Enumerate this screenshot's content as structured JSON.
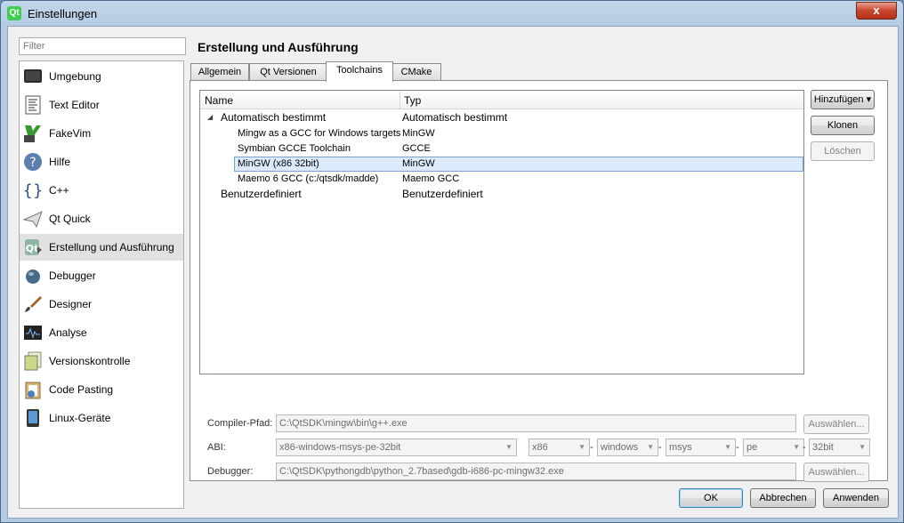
{
  "window": {
    "title": "Einstellungen",
    "close": "x",
    "app_icon": "Qt"
  },
  "filter": {
    "placeholder": "Filter"
  },
  "categories": [
    {
      "label": "Umgebung",
      "icon": "monitor-icon"
    },
    {
      "label": "Text Editor",
      "icon": "text-document-icon"
    },
    {
      "label": "FakeVim",
      "icon": "fakevim-icon"
    },
    {
      "label": "Hilfe",
      "icon": "help-icon"
    },
    {
      "label": "C++",
      "icon": "braces-icon"
    },
    {
      "label": "Qt Quick",
      "icon": "paper-plane-icon"
    },
    {
      "label": "Erstellung und Ausführung",
      "icon": "qt-build-icon"
    },
    {
      "label": "Debugger",
      "icon": "bug-icon"
    },
    {
      "label": "Designer",
      "icon": "brush-icon"
    },
    {
      "label": "Analyse",
      "icon": "oscilloscope-icon"
    },
    {
      "label": "Versionskontrolle",
      "icon": "document-stack-icon"
    },
    {
      "label": "Code Pasting",
      "icon": "clipboard-icon"
    },
    {
      "label": "Linux-Geräte",
      "icon": "device-icon"
    }
  ],
  "section_title": "Erstellung und Ausführung",
  "tabs": [
    "Allgemein",
    "Qt Versionen",
    "Toolchains",
    "CMake"
  ],
  "active_tab": "Toolchains",
  "tree": {
    "headers": {
      "name": "Name",
      "type": "Typ"
    },
    "group_auto": {
      "name": "Automatisch bestimmt",
      "type": "Automatisch bestimmt",
      "expand": "◢"
    },
    "items": [
      {
        "name": "Mingw as a GCC for Windows targets",
        "type": "MinGW"
      },
      {
        "name": "Symbian GCCE Toolchain",
        "type": "GCCE"
      },
      {
        "name": "MinGW (x86 32bit)",
        "type": "MinGW"
      },
      {
        "name": "Maemo 6 GCC (c:/qtsdk/madde)",
        "type": "Maemo GCC"
      }
    ],
    "group_user": {
      "name": "Benutzerdefiniert",
      "type": "Benutzerdefiniert"
    }
  },
  "side_buttons": {
    "add": "Hinzufügen",
    "clone": "Klonen",
    "remove": "Löschen"
  },
  "form": {
    "compiler_label": "Compiler-Pfad:",
    "compiler_value": "C:\\QtSDK\\mingw\\bin\\g++.exe",
    "browse": "Auswählen...",
    "abi_label": "ABI:",
    "abi": {
      "main": "x86-windows-msys-pe-32bit",
      "arch": "x86",
      "os": "windows",
      "flavor": "msys",
      "format": "pe",
      "width": "32bit"
    },
    "dash": "-",
    "debugger_label": "Debugger:",
    "debugger_value": "C:\\QtSDK\\pythongdb\\python_2.7based\\gdb-i686-pc-mingw32.exe"
  },
  "dialog_buttons": {
    "ok": "OK",
    "cancel": "Abbrechen",
    "apply": "Anwenden"
  }
}
